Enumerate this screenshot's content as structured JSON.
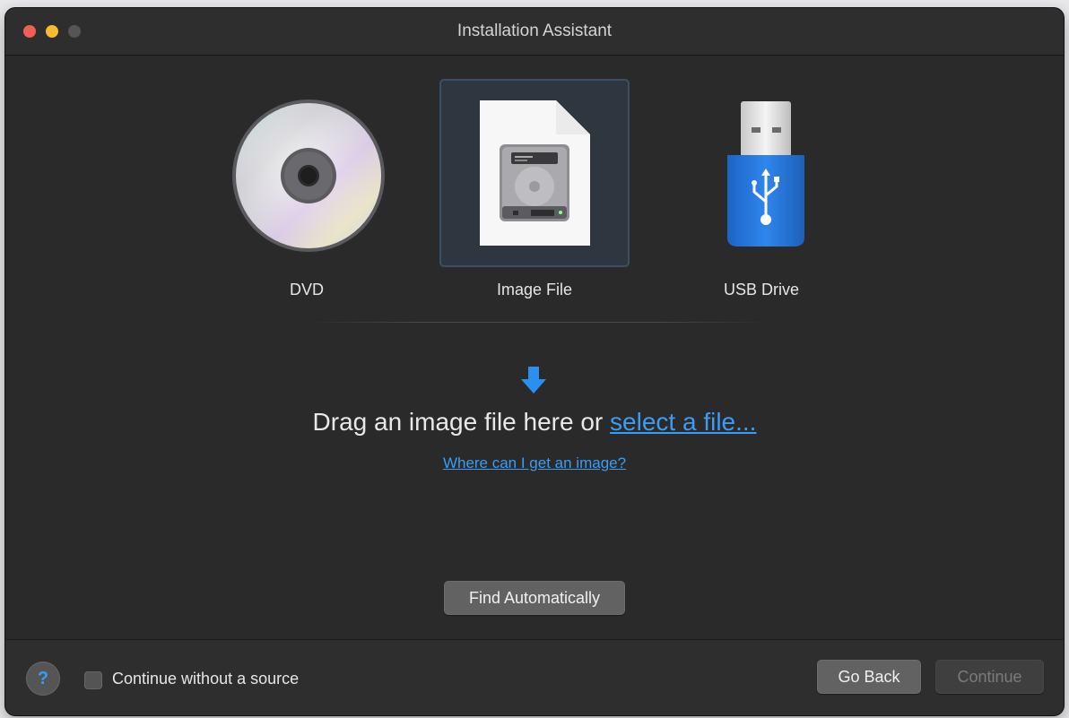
{
  "window": {
    "title": "Installation Assistant"
  },
  "sources": [
    {
      "label": "DVD",
      "icon": "dvd-icon",
      "selected": false
    },
    {
      "label": "Image File",
      "icon": "disk-image-file-icon",
      "selected": true
    },
    {
      "label": "USB Drive",
      "icon": "usb-drive-icon",
      "selected": false
    }
  ],
  "drop_area": {
    "arrow_icon": "down-arrow-icon",
    "text_prefix": "Drag an image file here or ",
    "select_link": "select a file...",
    "help_link": "Where can I get an image?"
  },
  "find_button": "Find Automatically",
  "footer": {
    "help_button": "?",
    "checkbox_label": "Continue without a source",
    "checkbox_checked": false,
    "back_button": "Go Back",
    "continue_button": "Continue"
  },
  "colors": {
    "accent": "#3b9cf5",
    "close": "#ee5f57",
    "minimize": "#f4bd2f"
  }
}
